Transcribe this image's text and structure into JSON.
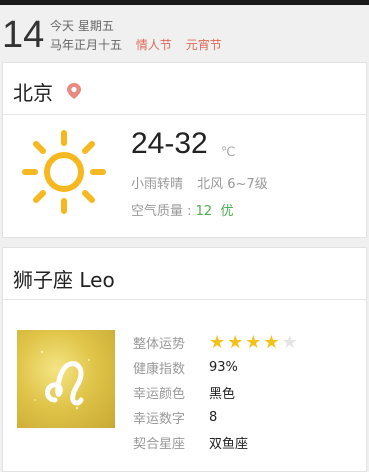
{
  "date": {
    "day": "14",
    "line1": "今天 星期五",
    "lunar": "马年正月十五",
    "festivals": [
      "情人节",
      "元宵节"
    ]
  },
  "weather": {
    "city": "北京",
    "temp_range": "24-32",
    "unit": "℃",
    "condition": "小雨转晴",
    "wind": "北风 6~7级",
    "aqi_label": "空气质量 : ",
    "aqi_value": "12",
    "aqi_level": "优"
  },
  "horoscope": {
    "title": "狮子座 Leo",
    "rows": [
      {
        "label": "整体运势",
        "value": "",
        "stars": 4,
        "max_stars": 5
      },
      {
        "label": "健康指数",
        "value": "93%"
      },
      {
        "label": "幸运颜色",
        "value": "黑色"
      },
      {
        "label": "幸运数字",
        "value": "8"
      },
      {
        "label": "契合星座",
        "value": "双鱼座"
      }
    ]
  },
  "colors": {
    "accent_red": "#e06a5a",
    "sun_yellow": "#f6b820",
    "star_gold": "#f3c21a",
    "aqi_green": "#4caf50"
  }
}
